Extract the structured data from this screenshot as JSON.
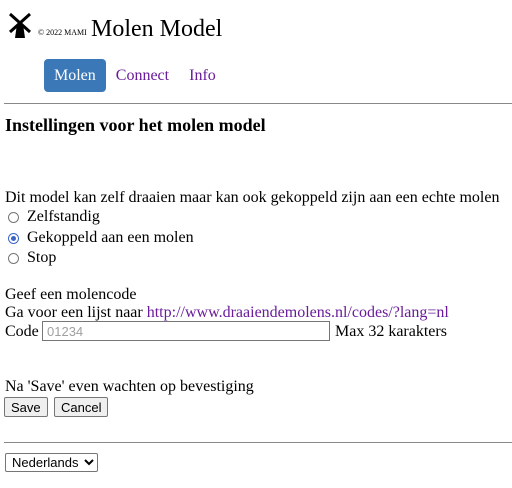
{
  "header": {
    "copyright": "© 2022 MAMI",
    "title": "Molen Model",
    "logo_icon": "windmill-icon"
  },
  "nav": {
    "tabs": [
      {
        "label": "Molen",
        "active": true
      },
      {
        "label": "Connect",
        "active": false
      },
      {
        "label": "Info",
        "active": false
      }
    ]
  },
  "page": {
    "heading": "Instellingen voor het molen model",
    "description": "Dit model kan zelf draaien maar kan ook gekoppeld zijn aan een echte molen",
    "mode_options": [
      {
        "label": "Zelfstandig",
        "checked": false
      },
      {
        "label": "Gekoppeld aan een molen",
        "checked": true
      },
      {
        "label": "Stop",
        "checked": false
      }
    ],
    "molencode": {
      "title": "Geef een molencode",
      "list_prefix": "Ga voor een lijst naar ",
      "list_link": "http://www.draaiendemolens.nl/codes/?lang=nl",
      "code_label": "Code",
      "code_value": "",
      "code_placeholder": "01234",
      "max_note": "Max 32 karakters"
    },
    "save_note": "Na 'Save' even wachten op bevestiging",
    "save_label": "Save",
    "cancel_label": "Cancel"
  },
  "footer": {
    "language_selected": "Nederlands"
  },
  "colors": {
    "active_tab": "#3b78b8",
    "link": "#6a1b9a"
  }
}
